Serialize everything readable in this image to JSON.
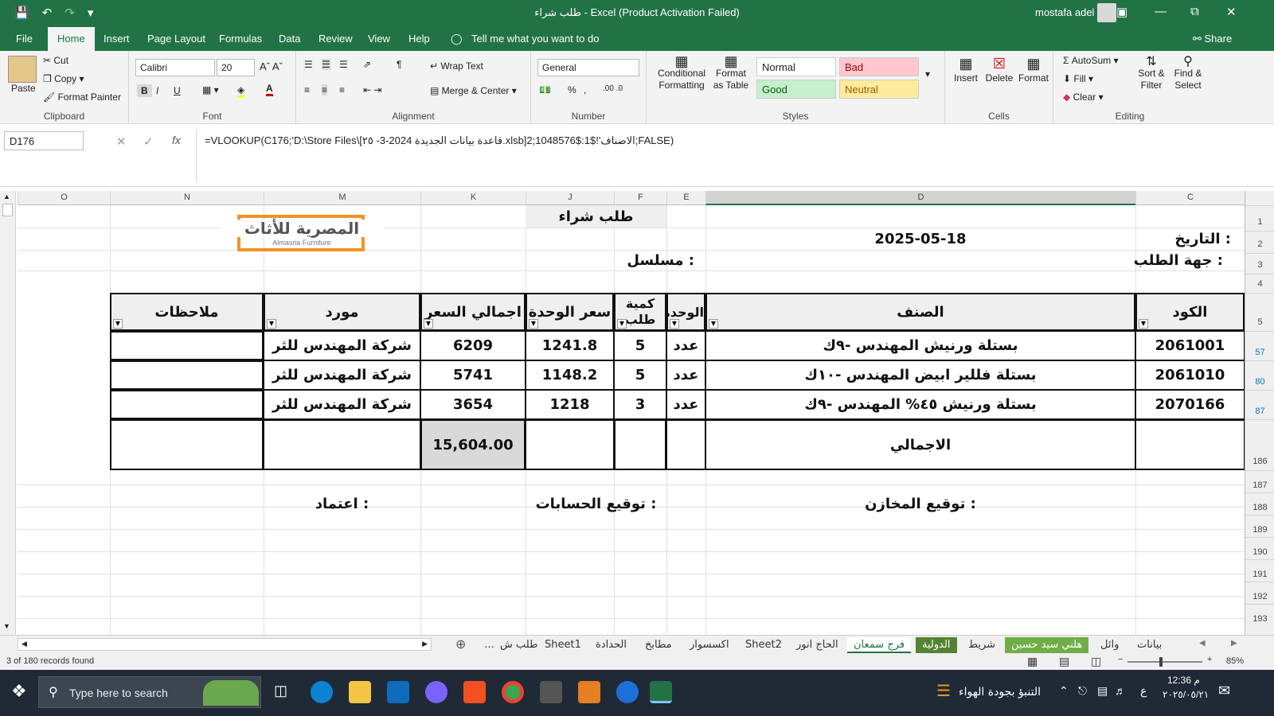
{
  "titlebar": {
    "title": "طلب شراء  -  Excel (Product Activation Failed)",
    "user": "mostafa adel"
  },
  "menu": {
    "file": "File",
    "home": "Home",
    "insert": "Insert",
    "page_layout": "Page Layout",
    "formulas": "Formulas",
    "data": "Data",
    "review": "Review",
    "view": "View",
    "help": "Help",
    "tell_me": "Tell me what you want to do",
    "share": "Share"
  },
  "ribbon": {
    "clipboard": {
      "paste": "Paste",
      "cut": "Cut",
      "copy": "Copy",
      "format_painter": "Format Painter",
      "label": "Clipboard"
    },
    "font": {
      "name": "Calibri",
      "size": "20",
      "label": "Font"
    },
    "alignment": {
      "wrap_text": "Wrap Text",
      "merge_center": "Merge & Center",
      "label": "Alignment"
    },
    "number": {
      "format": "General",
      "label": "Number"
    },
    "styles": {
      "conditional": "Conditional Formatting",
      "format_table": "Format as Table",
      "normal": "Normal",
      "bad": "Bad",
      "good": "Good",
      "neutral": "Neutral",
      "label": "Styles"
    },
    "cells": {
      "insert": "Insert",
      "delete": "Delete",
      "format": "Format",
      "label": "Cells"
    },
    "editing": {
      "autosum": "AutoSum",
      "fill": "Fill",
      "clear": "Clear",
      "sort_filter": "Sort & Filter",
      "find_select": "Find & Select",
      "label": "Editing"
    }
  },
  "formula_bar": {
    "name_box": "D176",
    "formula": "=VLOOKUP(C176;'D:\\Store  Files\\[٢٥ -3-قاعدة بيانات الجديدة 2024.xlsb]الاصناف'!$1:$1048576;2;FALSE)"
  },
  "columns": [
    "O",
    "N",
    "M",
    "K",
    "J",
    "F",
    "E",
    "D",
    "C"
  ],
  "rows": [
    "1",
    "2",
    "3",
    "4",
    "5",
    "57",
    "80",
    "87",
    "186",
    "187",
    "188",
    "189",
    "190",
    "191",
    "192",
    "193"
  ],
  "sheet": {
    "title": "طلب شراء",
    "date_label": "التاريخ :",
    "date_value": "2025-05-18",
    "dept_label": "جهة الطلب :",
    "serial_label": "مسلسل :",
    "logo_ar": "المصرية للأثاث",
    "logo_en": "Almasria Furniture",
    "headers": {
      "code": "الكود",
      "item": "الصنف",
      "unit": "الوحدة",
      "qty": "كمية طلب",
      "unit_price": "سعر الوحدة",
      "total_price": "اجمالي السعر",
      "supplier": "مورد",
      "notes": "ملاحظات"
    },
    "items": [
      {
        "code": "2061001",
        "item": "بستلة ورنيش  المهندس -٩ك",
        "unit": "عدد",
        "qty": "5",
        "unit_price": "1241.8",
        "total_price": "6209",
        "supplier": "شركة المهندس للثر",
        "notes": ""
      },
      {
        "code": "2061010",
        "item": "بستلة فللير ابيض المهندس -١٠ك",
        "unit": "عدد",
        "qty": "5",
        "unit_price": "1148.2",
        "total_price": "5741",
        "supplier": "شركة المهندس للثر",
        "notes": ""
      },
      {
        "code": "2070166",
        "item": "بستلة ورنيش ٤٥% المهندس -٩ك",
        "unit": "عدد",
        "qty": "3",
        "unit_price": "1218",
        "total_price": "3654",
        "supplier": "شركة المهندس للثر",
        "notes": ""
      }
    ],
    "total_label": "الاجمالي",
    "total_value": "15,604.00",
    "sign_stores": "توقيع المخازن :",
    "sign_accounts": "توقيع الحسابات :",
    "approval": "اعتماد :"
  },
  "sheet_tabs": [
    "بيانات",
    "وائل",
    "هلني سيد حسين",
    "شريط",
    "الدولية",
    "فرج سمعان",
    "الحاج انور",
    "Sheet2",
    "اكسسوار",
    "مطابخ",
    "الحدادة",
    "Sheet1",
    "طلب ش"
  ],
  "active_sheet": "فرج سمعان",
  "status": {
    "records": "3 of 180 records found",
    "zoom": "85%"
  },
  "taskbar": {
    "search": "Type here to search",
    "weather": "التنبؤ بجودة الهواء",
    "time": "12:36 م",
    "date": "٢٠٢٥/٠٥/٢١",
    "lang": "ع"
  },
  "colors": {
    "excel_green": "#217346",
    "bad_bg": "#ffc7ce",
    "good_bg": "#c6efce",
    "neutral_bg": "#ffeb9c",
    "logo_orange": "#f39224"
  }
}
